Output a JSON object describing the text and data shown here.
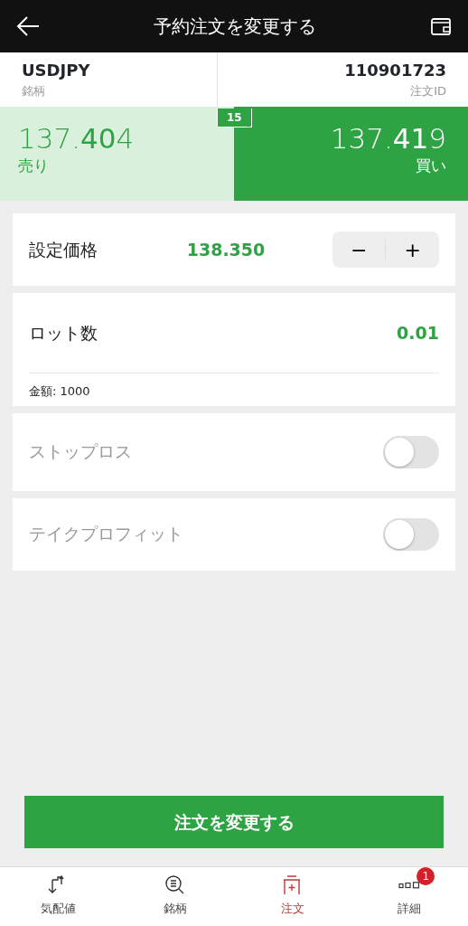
{
  "header": {
    "title": "予約注文を変更する"
  },
  "info": {
    "symbol": "USDJPY",
    "symbol_label": "銘柄",
    "order_id": "110901723",
    "order_id_label": "注文ID"
  },
  "quotes": {
    "spread": "15",
    "sell": {
      "price": "137.**40**4",
      "label": "売り"
    },
    "buy": {
      "price": "137.**41**9",
      "label": "買い"
    }
  },
  "settings": [
    {
      "kind": "stepper",
      "label": "設定価格",
      "value": "138.350",
      "minus": "−",
      "plus": "+"
    },
    {
      "kind": "value",
      "label": "ロット数",
      "value": "0.01",
      "note": "金額: 1000"
    },
    {
      "kind": "toggle",
      "label": "ストップロス",
      "on": false
    },
    {
      "kind": "toggle",
      "label": "テイクプロフィット",
      "on": false
    }
  ],
  "submit": "注文を変更する",
  "bottom_nav": [
    {
      "label": "気配値",
      "selected": false
    },
    {
      "label": "銘柄",
      "selected": false
    },
    {
      "label": "注文",
      "selected": true
    },
    {
      "label": "詳細",
      "selected": false,
      "badge": "1"
    }
  ]
}
